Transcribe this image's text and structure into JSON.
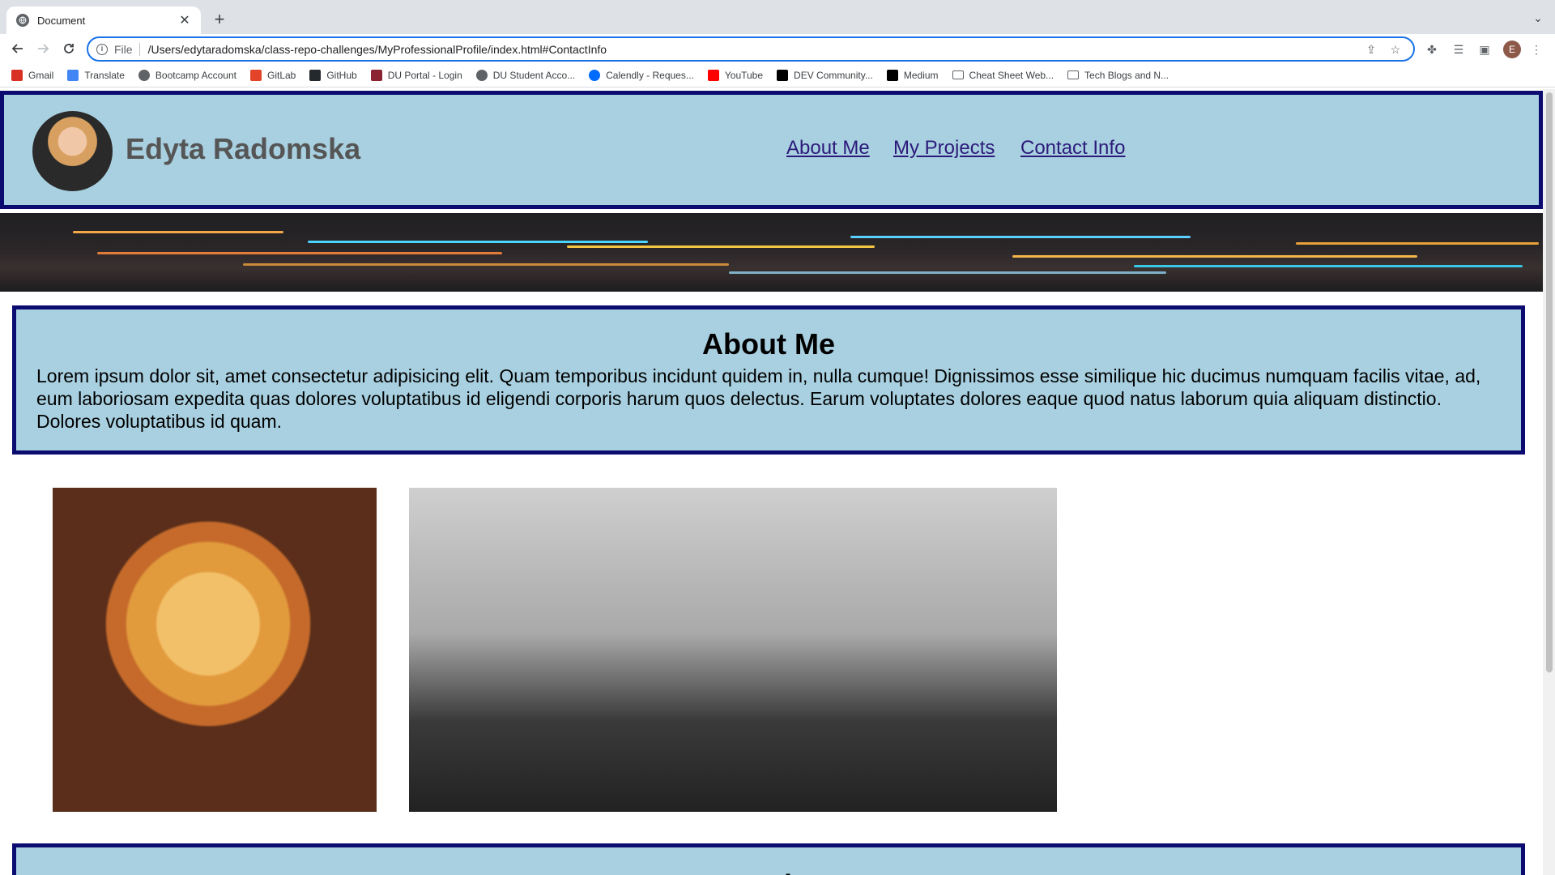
{
  "browser": {
    "tab_title": "Document",
    "new_tab": "+",
    "url_scheme": "File",
    "url": "/Users/edytaradomska/class-repo-challenges/MyProfessionalProfile/index.html#ContactInfo",
    "profile_initial": "E"
  },
  "bookmarks": [
    {
      "label": "Gmail",
      "icon": "gmail-icon",
      "color": "#d93025"
    },
    {
      "label": "Translate",
      "icon": "translate-icon",
      "color": "#4285f4"
    },
    {
      "label": "Bootcamp Account",
      "icon": "globe-icon",
      "color": "#5f6368"
    },
    {
      "label": "GitLab",
      "icon": "gitlab-icon",
      "color": "#e24329"
    },
    {
      "label": "GitHub",
      "icon": "github-icon",
      "color": "#24292e"
    },
    {
      "label": "DU Portal - Login",
      "icon": "du-icon",
      "color": "#8b2332"
    },
    {
      "label": "DU Student Acco...",
      "icon": "globe-icon",
      "color": "#5f6368"
    },
    {
      "label": "Calendly - Reques...",
      "icon": "calendly-icon",
      "color": "#006bff"
    },
    {
      "label": "YouTube",
      "icon": "youtube-icon",
      "color": "#ff0000"
    },
    {
      "label": "DEV Community...",
      "icon": "dev-icon",
      "color": "#000000"
    },
    {
      "label": "Medium",
      "icon": "medium-icon",
      "color": "#000000"
    },
    {
      "label": "Cheat Sheet Web...",
      "icon": "folder-icon",
      "color": "#5f6368"
    },
    {
      "label": "Tech Blogs and N...",
      "icon": "folder-icon",
      "color": "#5f6368"
    }
  ],
  "header": {
    "name": "Edyta Radomska",
    "nav": [
      "About Me",
      "My Projects",
      "Contact Info"
    ]
  },
  "about": {
    "heading": "About Me",
    "body": "Lorem ipsum dolor sit, amet consectetur adipisicing elit. Quam temporibus incidunt quidem in, nulla cumque! Dignissimos esse similique hic ducimus numquam facilis vitae, ad, eum laboriosam expedita quas dolores voluptatibus id eligendi corporis harum quos delectus. Earum voluptates dolores eaque quod natus laborum quia aliquam distinctio. Dolores voluptatibus id quam."
  },
  "projects": {
    "heading": "My Projects"
  },
  "colors": {
    "section_bg": "#a8d0e0",
    "section_border": "#0c0c70",
    "link": "#2c1a7a"
  }
}
